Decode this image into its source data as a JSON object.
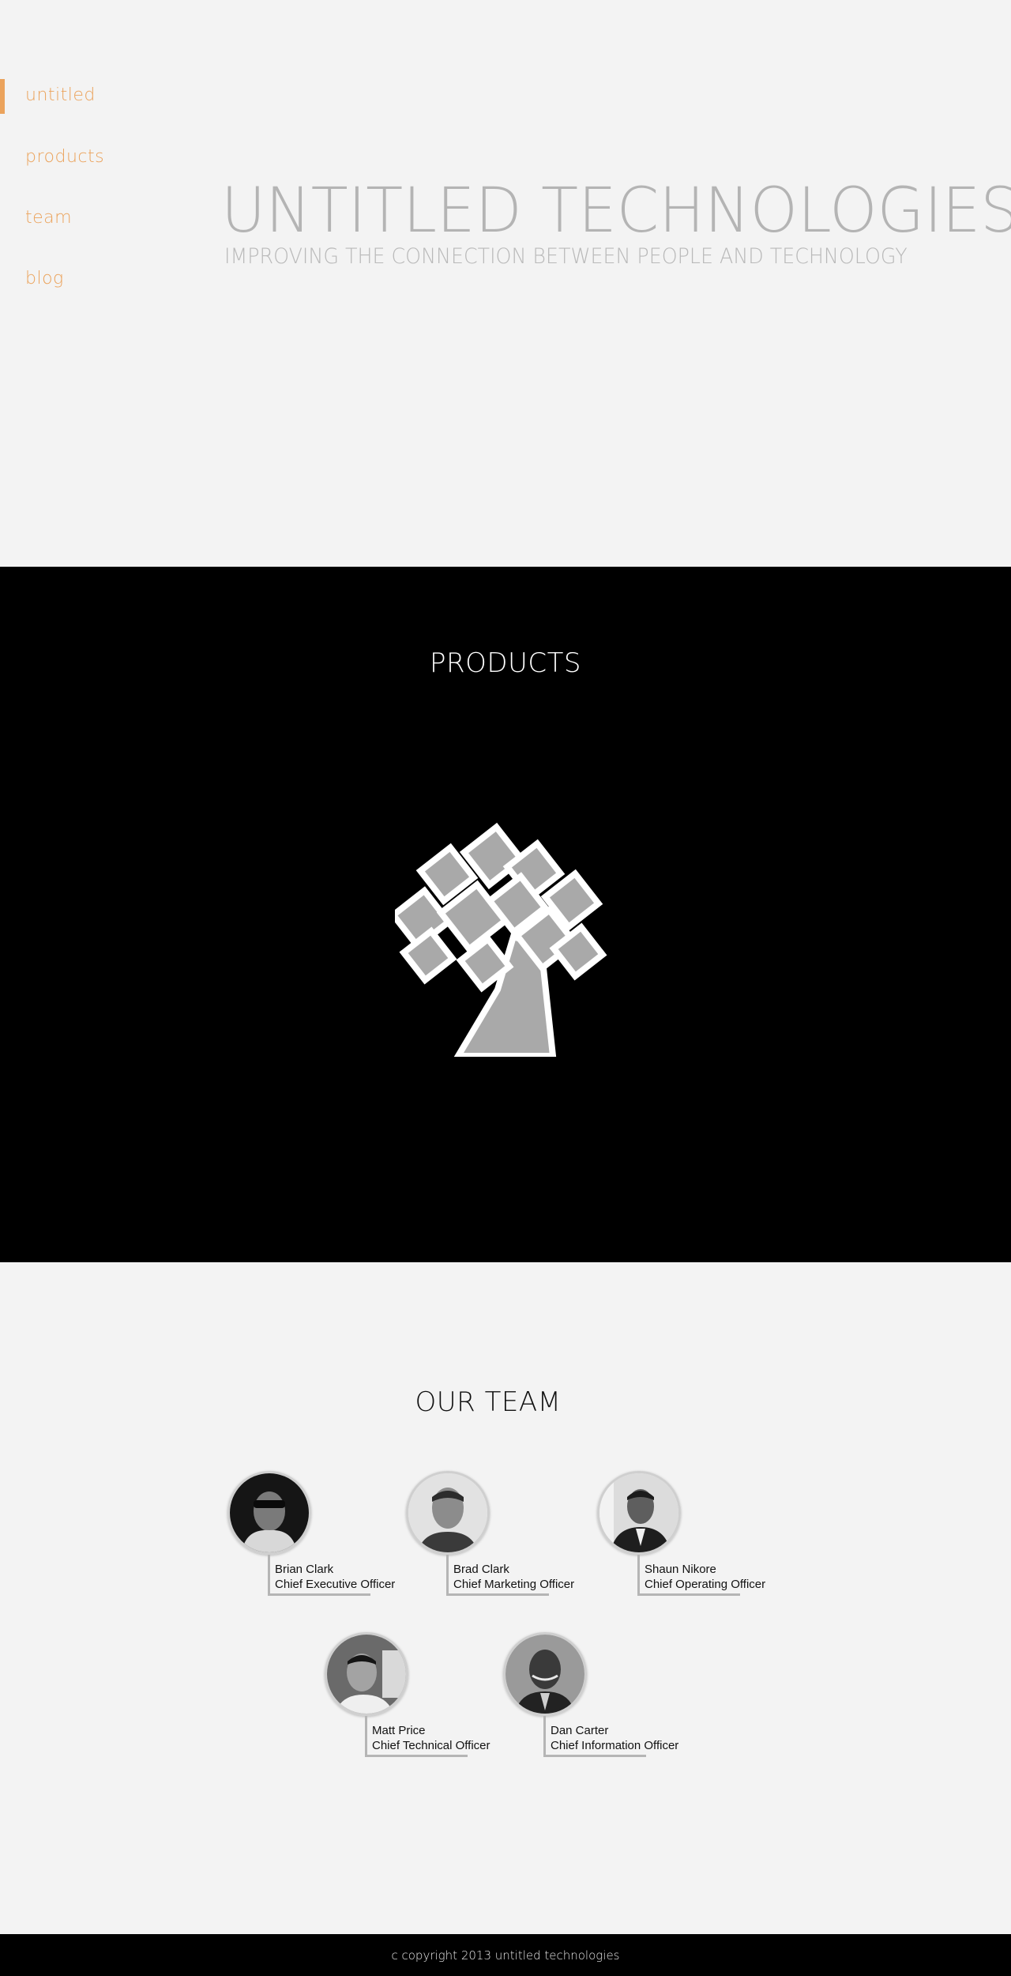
{
  "nav": {
    "items": [
      {
        "label": "untitled",
        "active": true
      },
      {
        "label": "products",
        "active": false
      },
      {
        "label": "team",
        "active": false
      },
      {
        "label": "blog",
        "active": false
      }
    ]
  },
  "hero": {
    "title": "UNTITLED TECHNOLOGIES",
    "subtitle": "IMPROVING THE CONNECTION BETWEEN PEOPLE AND TECHNOLOGY"
  },
  "products": {
    "title": "PRODUCTS",
    "logo_icon": "tree-logo-icon"
  },
  "team": {
    "title": "OUR TEAM",
    "members": [
      {
        "name": "Brian Clark",
        "role": "Chief Executive Officer"
      },
      {
        "name": "Brad Clark",
        "role": "Chief Marketing Officer"
      },
      {
        "name": "Shaun Nikore",
        "role": "Chief Operating Officer"
      },
      {
        "name": "Matt Price",
        "role": "Chief Technical Officer"
      },
      {
        "name": "Dan Carter",
        "role": "Chief Information Officer"
      }
    ]
  },
  "footer": {
    "copyright": "c copyright 2013 untitled technologies"
  },
  "colors": {
    "accent": "#eba35c",
    "hero_text": "#b4b4b4",
    "products_bg": "#000000",
    "page_bg": "#f3f3f3"
  }
}
